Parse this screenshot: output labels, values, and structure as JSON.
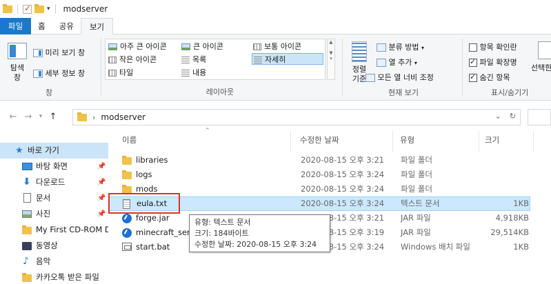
{
  "window": {
    "title": "modserver"
  },
  "tabs": [
    {
      "label": "파일"
    },
    {
      "label": "홈"
    },
    {
      "label": "공유"
    },
    {
      "label": "보기"
    }
  ],
  "ribbon": {
    "pane": {
      "nav_pane_label": "탐색\n창",
      "preview_label": "미리 보기 창",
      "details_label": "세부 정보 창",
      "group_label": "창"
    },
    "layout": {
      "items": [
        "아주 큰 아이콘",
        "큰 아이콘",
        "보통 아이콘",
        "작은 아이콘",
        "목록",
        "자세히",
        "타일",
        "내용"
      ],
      "group_label": "레이아웃"
    },
    "current_view": {
      "sort_label": "정렬\n기준",
      "group_by_label": "분류 방법",
      "add_column_label": "열 추가",
      "fit_columns_label": "모든 열 너비 조정",
      "group_label": "현재 보기"
    },
    "show_hide": {
      "item_checkboxes": "항목 확인란",
      "file_extensions": "파일 확장명",
      "hidden_items": "숨긴 항목",
      "hide_selected": "선택한",
      "group_label": "표시/숨기기",
      "states": {
        "item_checkboxes": false,
        "file_extensions": true,
        "hidden_items": true
      }
    }
  },
  "address": {
    "path": "modserver"
  },
  "nav": {
    "items": [
      {
        "label": "바로 가기",
        "icon": "star-icon",
        "pinned": false
      },
      {
        "label": "바탕 화면",
        "icon": "desktop-icon",
        "pinned": true
      },
      {
        "label": "다운로드",
        "icon": "download-icon",
        "pinned": true
      },
      {
        "label": "문서",
        "icon": "documents-icon",
        "pinned": true
      },
      {
        "label": "사진",
        "icon": "pictures-icon",
        "pinned": true
      },
      {
        "label": "My First CD-ROM D",
        "icon": "folder-icon",
        "pinned": false
      },
      {
        "label": "동영상",
        "icon": "videos-icon",
        "pinned": false
      },
      {
        "label": "음악",
        "icon": "music-icon",
        "pinned": false
      },
      {
        "label": "카카오톡 받은 파일",
        "icon": "folder-icon",
        "pinned": false
      }
    ]
  },
  "columns": {
    "name": "이름",
    "modified": "수정한 날짜",
    "type": "유형",
    "size": "크기"
  },
  "files": [
    {
      "name": "libraries",
      "modified": "2020-08-15 오후 3:21",
      "type": "파일 폴더",
      "size": "",
      "icon": "folder-icon"
    },
    {
      "name": "logs",
      "modified": "2020-08-15 오후 3:24",
      "type": "파일 폴더",
      "size": "",
      "icon": "folder-icon"
    },
    {
      "name": "mods",
      "modified": "2020-08-15 오후 3:24",
      "type": "파일 폴더",
      "size": "",
      "icon": "folder-icon"
    },
    {
      "name": "eula.txt",
      "modified": "2020-08-15 오후 3:24",
      "type": "텍스트 문서",
      "size": "1KB",
      "icon": "text-file-icon"
    },
    {
      "name": "forge.jar",
      "modified": "2020-08-15 오후 3:21",
      "type": "JAR 파일",
      "size": "4,918KB",
      "icon": "jar-icon"
    },
    {
      "name": "minecraft_server.jar",
      "modified": "2020-08-15 오후 3:19",
      "type": "JAR 파일",
      "size": "29,514KB",
      "icon": "jar-icon"
    },
    {
      "name": "start.bat",
      "modified": "2020-08-15 오후 3:24",
      "type": "Windows 배치 파일",
      "size": "1KB",
      "icon": "batch-file-icon"
    }
  ],
  "tooltip": {
    "type": "유형: 텍스트 문서",
    "size": "크기: 184바이트",
    "modified": "수정한 날짜: 2020-08-15 오후 3:24"
  },
  "colors": {
    "file_tab": "#1979ca",
    "selection": "#cce8ff",
    "highlight_box": "#d9322b"
  }
}
